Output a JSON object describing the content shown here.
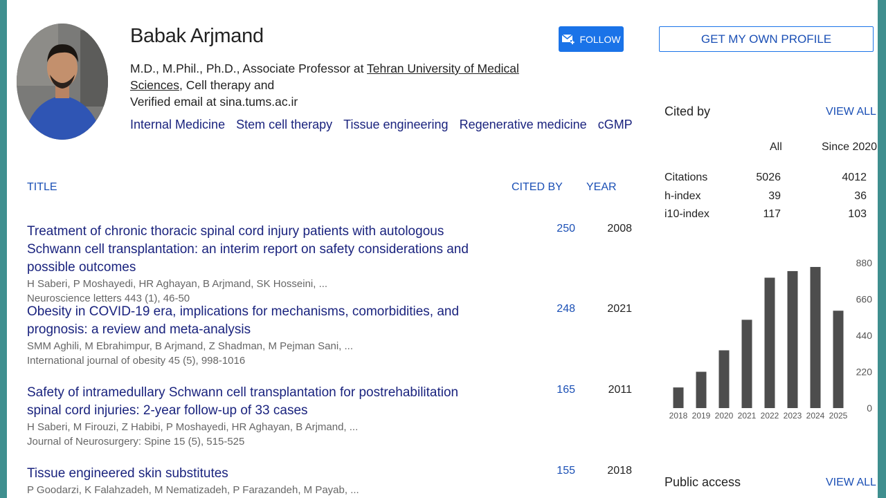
{
  "profile": {
    "name": "Babak Arjmand",
    "affiliation_prefix": "M.D., M.Phil., Ph.D., Associate Professor at ",
    "affiliation_link": "Tehran University of Medical Sciences",
    "affiliation_suffix": ", Cell therapy and",
    "email": "Verified email at sina.tums.ac.ir",
    "interests": [
      "Internal Medicine",
      "Stem cell therapy",
      "Tissue engineering",
      "Regenerative medicine",
      "cGMP"
    ]
  },
  "buttons": {
    "follow": "FOLLOW",
    "own_profile": "GET MY OWN PROFILE"
  },
  "table": {
    "title_header": "TITLE",
    "cited_header": "CITED BY",
    "year_header": "YEAR",
    "articles": [
      {
        "title": "Treatment of chronic thoracic spinal cord injury patients with autologous Schwann cell transplantation: an interim report on safety considerations and possible outcomes",
        "authors": "H Saberi, P Moshayedi, HR Aghayan, B Arjmand, SK Hosseini, ...",
        "venue": "Neuroscience letters 443 (1), 46-50",
        "cited": "250",
        "year": "2008"
      },
      {
        "title": "Obesity in COVID-19 era, implications for mechanisms, comorbidities, and prognosis: a review and meta-analysis",
        "authors": "SMM Aghili, M Ebrahimpur, B Arjmand, Z Shadman, M Pejman Sani, ...",
        "venue": "International journal of obesity 45 (5), 998-1016",
        "cited": "248",
        "year": "2021"
      },
      {
        "title": "Safety of intramedullary Schwann cell transplantation for postrehabilitation spinal cord injuries: 2-year follow-up of 33 cases",
        "authors": "H Saberi, M Firouzi, Z Habibi, P Moshayedi, HR Aghayan, B Arjmand, ...",
        "venue": "Journal of Neurosurgery: Spine 15 (5), 515-525",
        "cited": "165",
        "year": "2011"
      },
      {
        "title": "Tissue engineered skin substitutes",
        "authors": "P Goodarzi, K Falahzadeh, M Nematizadeh, P Farazandeh, M Payab, ...",
        "venue": "",
        "cited": "155",
        "year": "2018"
      }
    ]
  },
  "cited_by": {
    "label": "Cited by",
    "view_all": "VIEW ALL",
    "col_all": "All",
    "col_since": "Since 2020",
    "rows": [
      {
        "label": "Citations",
        "all": "5026",
        "since": "4012"
      },
      {
        "label": "h-index",
        "all": "39",
        "since": "36"
      },
      {
        "label": "i10-index",
        "all": "117",
        "since": "103"
      }
    ]
  },
  "public_access": {
    "label": "Public access",
    "view_all": "VIEW ALL"
  },
  "chart_data": {
    "type": "bar",
    "categories": [
      "2018",
      "2019",
      "2020",
      "2021",
      "2022",
      "2023",
      "2024",
      "2025"
    ],
    "values": [
      125,
      220,
      350,
      535,
      790,
      830,
      855,
      590
    ],
    "yticks": [
      "880",
      "660",
      "440",
      "220",
      "0"
    ],
    "ylim": [
      0,
      880
    ],
    "title": "",
    "xlabel": "",
    "ylabel": "",
    "bar_color": "#4d4d4d"
  },
  "colors": {
    "accent": "#1a73e8",
    "link": "#1a237e",
    "frame": "#3f8f8f"
  }
}
